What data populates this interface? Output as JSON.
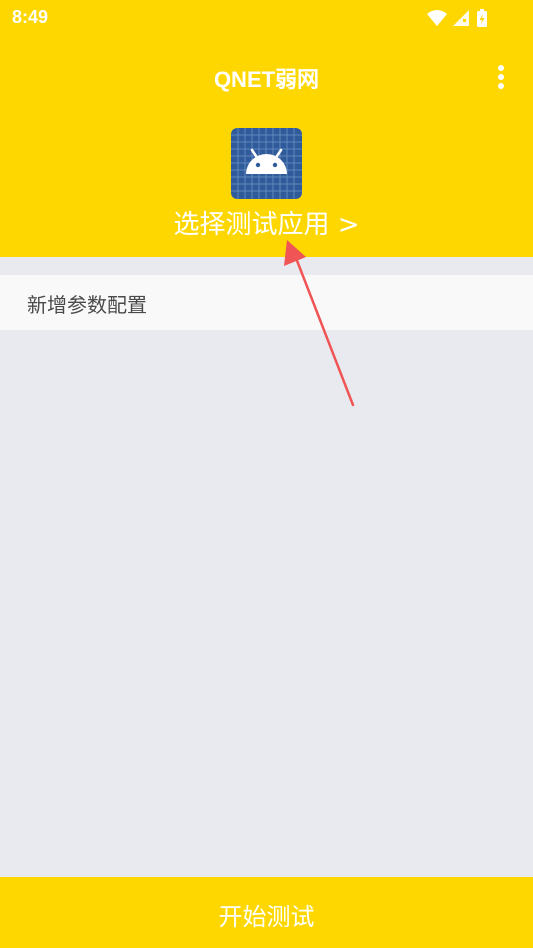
{
  "status_bar": {
    "time": "8:49"
  },
  "app_bar": {
    "title": "QNET弱网",
    "menu_icon": "more-vert-icon"
  },
  "header": {
    "app_icon": "android-icon",
    "select_app_label": "选择测试应用 >"
  },
  "config": {
    "add_label": "新增参数配置"
  },
  "footer": {
    "start_label": "开始测试"
  },
  "colors": {
    "accent": "#FFD700",
    "background": "#E9EAEF",
    "annotation_arrow": "#F05454",
    "icon_tile": "#2F5B9A"
  }
}
